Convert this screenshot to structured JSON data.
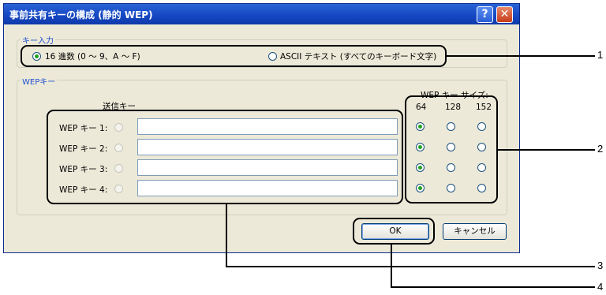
{
  "window": {
    "title": "事前共有キーの構成 (静的 WEP)",
    "help_glyph": "?",
    "close_glyph": "✕"
  },
  "key_input": {
    "legend": "キー入力",
    "option_hex": "16 進数 (0 ～ 9、A ～ F)",
    "option_ascii": "ASCII テキスト (すべてのキーボード文字)",
    "selected": "hex"
  },
  "wep_keys": {
    "legend": "WEPキー",
    "transmit_header": "送信キー",
    "size_header": "WEP キー サイズ:",
    "sizes": [
      "64",
      "128",
      "152"
    ],
    "rows": [
      {
        "label": "WEP キー 1:",
        "value": "",
        "size": "64"
      },
      {
        "label": "WEP キー 2:",
        "value": "",
        "size": "64"
      },
      {
        "label": "WEP キー 3:",
        "value": "",
        "size": "64"
      },
      {
        "label": "WEP キー 4:",
        "value": "",
        "size": "64"
      }
    ]
  },
  "buttons": {
    "ok": "OK",
    "cancel": "キャンセル"
  },
  "callouts": [
    "1",
    "2",
    "3",
    "4"
  ]
}
